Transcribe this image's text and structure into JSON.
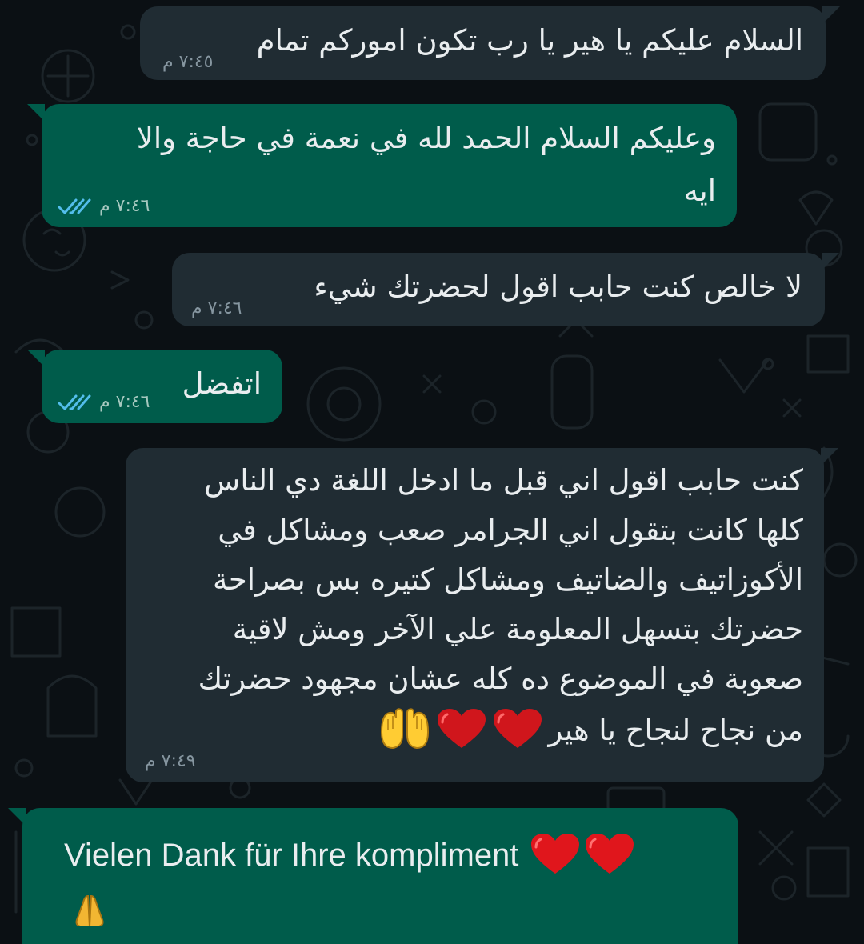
{
  "colors": {
    "background": "#0b1014",
    "incoming_bubble": "#202c33",
    "outgoing_bubble": "#005c4b",
    "text": "#e9edef",
    "timestamp": "#8696a0",
    "read_ticks": "#53bdeb"
  },
  "messages": [
    {
      "direction": "incoming",
      "text": "السلام عليكم يا هير يا رب تكون اموركم تمام",
      "time": "٧:٤٥ م"
    },
    {
      "direction": "outgoing",
      "text_line1": "وعليكم السلام الحمد لله في نعمة في حاجة والا",
      "text_line2": "ايه",
      "time": "٧:٤٦ م",
      "status_icon": "double-check-read-icon"
    },
    {
      "direction": "incoming",
      "text": "لا خالص كنت حابب اقول لحضرتك شيء",
      "time": "٧:٤٦ م"
    },
    {
      "direction": "outgoing",
      "text": "اتفضل",
      "time": "٧:٤٦ م",
      "status_icon": "double-check-read-icon"
    },
    {
      "direction": "incoming",
      "lines": [
        "كنت حابب اقول اني قبل ما ادخل اللغة دي الناس",
        "كلها كانت بتقول اني الجرامر صعب ومشاكل في",
        "الأكوزاتيف والضاتيف ومشاكل كتيره بس بصراحة",
        "حضرتك بتسهل المعلومة علي الآخر ومش لاقية",
        "صعوبة في الموضوع ده كله عشان مجهود حضرتك",
        "من نجاح لنجاح يا هير"
      ],
      "emojis": [
        "red-heart-icon",
        "red-heart-icon",
        "raising-hands-icon"
      ],
      "time": "٧:٤٩ م"
    },
    {
      "direction": "outgoing",
      "text": "Vielen Dank für Ihre kompliment",
      "emojis": [
        "red-heart-icon",
        "red-heart-icon",
        "folded-hands-icon"
      ]
    }
  ]
}
